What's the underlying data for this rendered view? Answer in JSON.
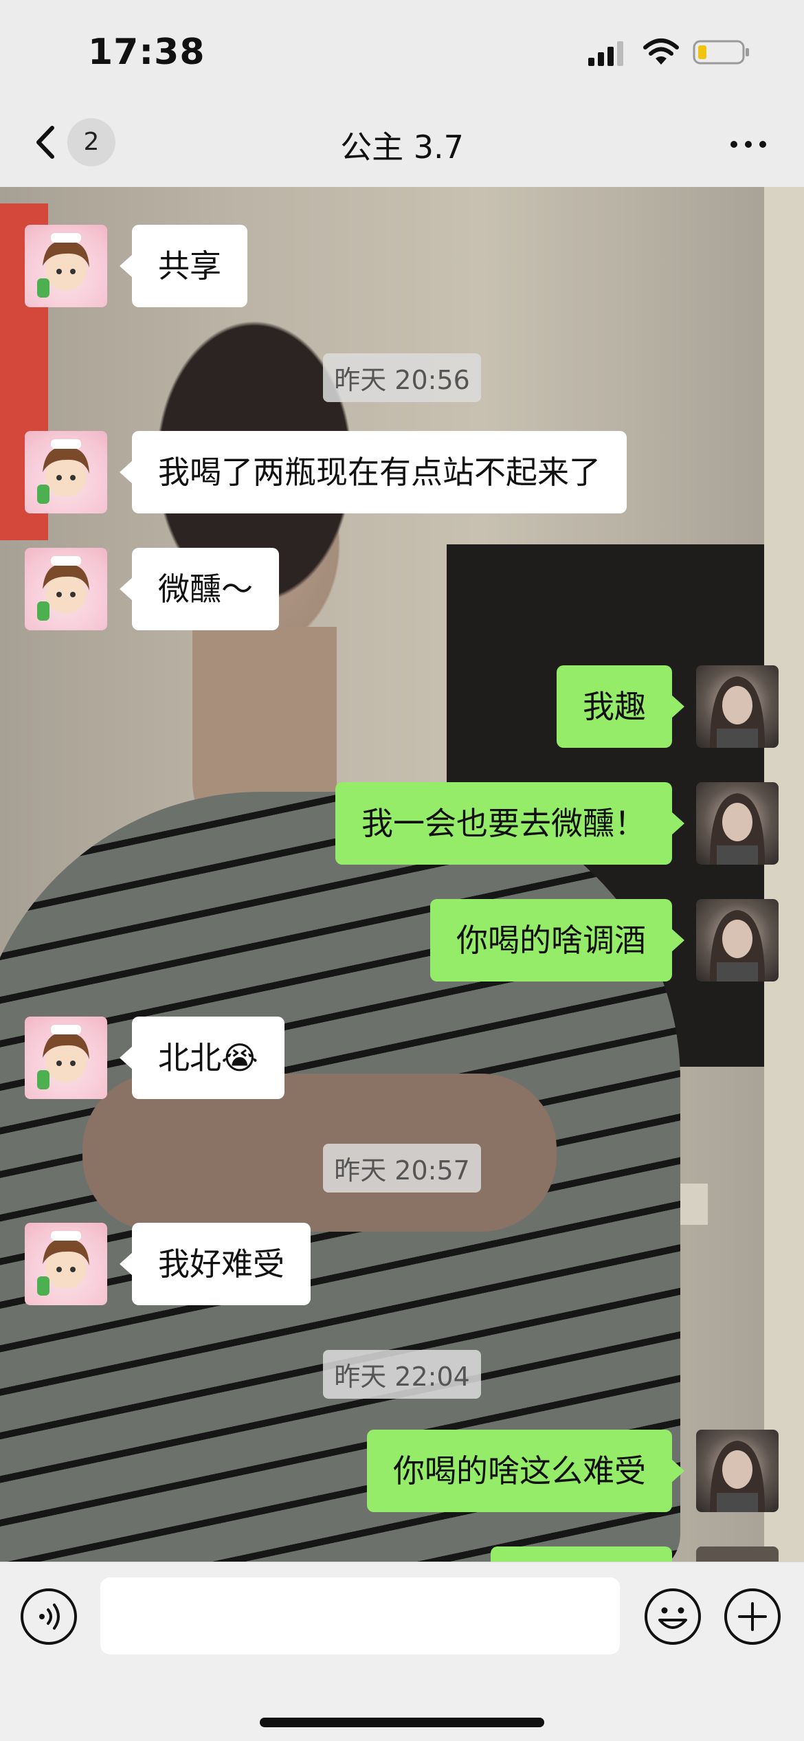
{
  "status_bar": {
    "time": "17:38"
  },
  "header": {
    "unread_count": "2",
    "title": "公主 3.7"
  },
  "messages": [
    {
      "side": "them",
      "text": "共享"
    },
    {
      "type": "time",
      "text": "昨天 20:56"
    },
    {
      "side": "them",
      "text": "我喝了两瓶现在有点站不起来了"
    },
    {
      "side": "them",
      "text": "微醺～"
    },
    {
      "side": "me",
      "text": "我趣"
    },
    {
      "side": "me",
      "text": "我一会也要去微醺！"
    },
    {
      "side": "me",
      "text": "你喝的啥调酒"
    },
    {
      "side": "them",
      "text": "北北😭"
    },
    {
      "type": "time",
      "text": "昨天 20:57"
    },
    {
      "side": "them",
      "text": "我好难受"
    },
    {
      "type": "time",
      "text": "昨天 22:04"
    },
    {
      "side": "me",
      "text": "你喝的啥这么难受"
    }
  ],
  "input": {
    "placeholder": ""
  },
  "colors": {
    "my_bubble": "#95ec69",
    "their_bubble": "#ffffff",
    "bar_background": "#ececec"
  },
  "icons": [
    "back-icon",
    "more-icon",
    "voice-icon",
    "emoji-icon",
    "plus-icon",
    "signal-icon",
    "wifi-icon",
    "battery-icon"
  ]
}
